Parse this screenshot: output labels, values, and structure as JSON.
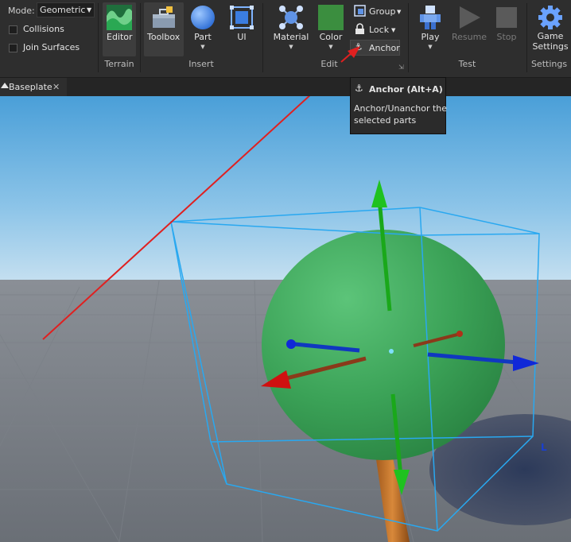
{
  "mode": {
    "label": "Mode:",
    "value": "Geometric"
  },
  "options": {
    "collisions": "Collisions",
    "join_surfaces": "Join Surfaces"
  },
  "groups": {
    "terrain": "Terrain",
    "insert": "Insert",
    "edit": "Edit",
    "test": "Test",
    "settings": "Settings"
  },
  "buttons": {
    "editor": "Editor",
    "toolbox": "Toolbox",
    "part": "Part",
    "ui": "UI",
    "material": "Material",
    "color": "Color",
    "group": "Group",
    "lock": "Lock",
    "anchor": "Anchor",
    "play": "Play",
    "resume": "Resume",
    "stop": "Stop",
    "game_settings_1": "Game",
    "game_settings_2": "Settings"
  },
  "tab": {
    "name": "Baseplate",
    "close": "✕"
  },
  "tooltip": {
    "title": "Anchor (Alt+A)",
    "line1": "Anchor/Unanchor the",
    "line2": "selected parts"
  },
  "viewport": {
    "corner_marker": "L"
  },
  "colors": {
    "accent_selection": "#29a8f0",
    "sphere": "#3aa85a",
    "annotation_arrow": "#e02020"
  }
}
